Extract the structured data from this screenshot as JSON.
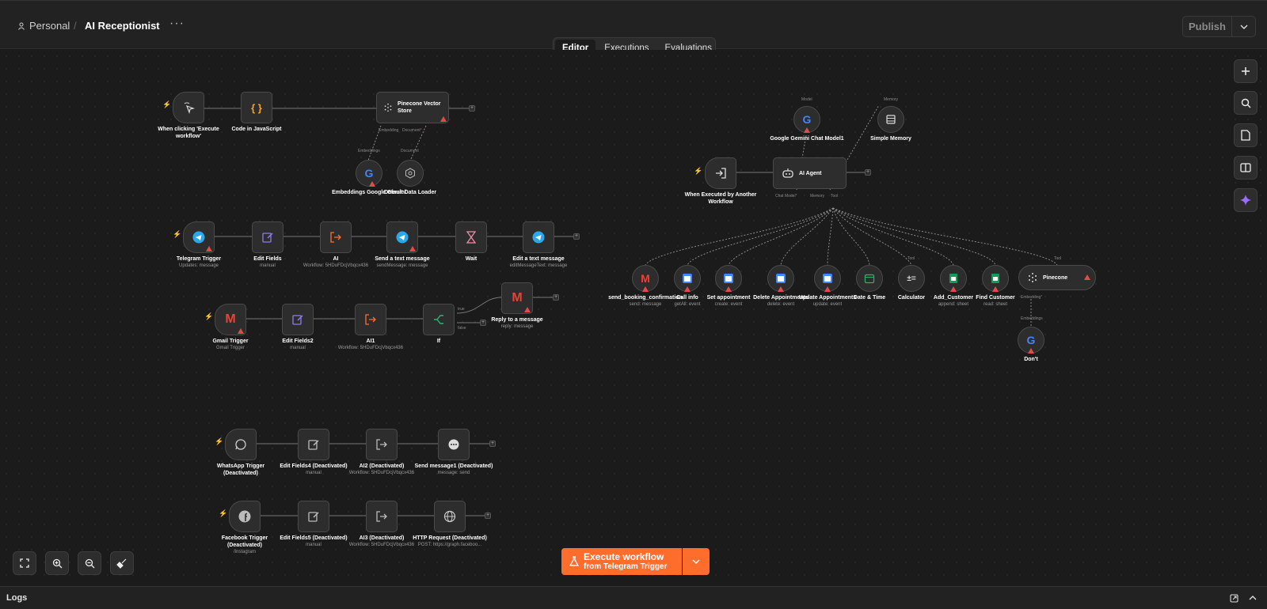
{
  "header": {
    "breadcrumb_personal": "Personal",
    "breadcrumb_separator": "/",
    "workflow_title": "AI Receptionist",
    "more_label": "···",
    "publish_label": "Publish"
  },
  "tabs": [
    {
      "label": "Editor",
      "active": true
    },
    {
      "label": "Executions",
      "active": false
    },
    {
      "label": "Evaluations",
      "active": false
    }
  ],
  "nodes": {
    "manual_trigger": {
      "label": "When clicking 'Execute workflow'",
      "icon": "cursor-click-icon"
    },
    "code_js": {
      "label": "Code in JavaScript",
      "icon": "braces-icon",
      "glyph": "{ }"
    },
    "pinecone_store": {
      "label": "Pinecone Vector Store",
      "icon": "pinecone-icon"
    },
    "embeddings_gemini": {
      "label": "Embeddings Google Gemini",
      "icon": "google-icon"
    },
    "default_loader": {
      "label": "Default Data Loader",
      "icon": "hexagon-icon"
    },
    "telegram_trigger": {
      "label": "Telegram Trigger",
      "sub": "Updates: message",
      "icon": "telegram-icon"
    },
    "edit_fields": {
      "label": "Edit Fields",
      "sub": "manual",
      "icon": "pencil-icon"
    },
    "ai": {
      "label": "AI",
      "sub": "Workflow: 5HDuFDcjVbqcx436",
      "icon": "execute-workflow-icon"
    },
    "send_text": {
      "label": "Send a text message",
      "sub": "sendMessage: message",
      "icon": "telegram-icon"
    },
    "wait": {
      "label": "Wait",
      "icon": "hourglass-icon"
    },
    "edit_text": {
      "label": "Edit a text message",
      "sub": "editMessageText: message",
      "icon": "telegram-icon"
    },
    "gmail_trigger": {
      "label": "Gmail Trigger",
      "sub": "Gmail Trigger",
      "icon": "gmail-icon"
    },
    "edit_fields2": {
      "label": "Edit Fields2",
      "sub": "manual",
      "icon": "pencil-icon"
    },
    "ai1": {
      "label": "AI1",
      "sub": "Workflow: 5HDuFDcjVbqcx436",
      "icon": "execute-workflow-icon"
    },
    "if": {
      "label": "If",
      "icon": "branch-icon",
      "true_label": "true",
      "false_label": "false"
    },
    "reply_message": {
      "label": "Reply to a message",
      "sub": "reply: message",
      "icon": "gmail-icon"
    },
    "whatsapp_trigger": {
      "label": "WhatsApp Trigger (Deactivated)",
      "icon": "whatsapp-icon"
    },
    "edit_fields4": {
      "label": "Edit Fields4 (Deactivated)",
      "sub": "manual",
      "icon": "pencil-icon"
    },
    "ai2": {
      "label": "AI2 (Deactivated)",
      "sub": "Workflow: 5HDuFDcjVbqcx436",
      "icon": "execute-workflow-icon"
    },
    "send_message1": {
      "label": "Send message1 (Deactivated)",
      "sub": "message: send",
      "icon": "chat-icon"
    },
    "facebook_trigger": {
      "label": "Facebook Trigger (Deactivated)",
      "sub": "/instagram",
      "icon": "facebook-icon"
    },
    "edit_fields5": {
      "label": "Edit Fields5 (Deactivated)",
      "sub": "manual",
      "icon": "pencil-icon"
    },
    "ai3": {
      "label": "AI3 (Deactivated)",
      "sub": "Workflow: 5HDuFDcjVbqcx436",
      "icon": "execute-workflow-icon"
    },
    "http_request": {
      "label": "HTTP Request (Deactivated)",
      "sub": "POST: https://graph.faceboo...",
      "icon": "globe-icon"
    },
    "gemini_chat": {
      "label": "Google Gemini Chat Model1",
      "icon": "google-icon"
    },
    "simple_memory": {
      "label": "Simple Memory",
      "icon": "database-icon"
    },
    "executed_trigger": {
      "label": "When Executed by Another Workflow",
      "icon": "enter-icon"
    },
    "ai_agent": {
      "label": "AI Agent",
      "icon": "robot-icon"
    },
    "send_booking": {
      "label": "send_booking_confirmation",
      "sub": "send: message",
      "icon": "gmail-icon"
    },
    "call_info": {
      "label": "Call info",
      "sub": "getAll: event",
      "icon": "calendar-icon"
    },
    "set_appointment": {
      "label": "Set appointment",
      "sub": "create: event",
      "icon": "calendar-icon"
    },
    "delete_appointments": {
      "label": "Delete Appointments",
      "sub": "delete: event",
      "icon": "calendar-icon"
    },
    "update_appointments": {
      "label": "Update Appointments",
      "sub": "update: event",
      "icon": "calendar-icon"
    },
    "date_time": {
      "label": "Date & Time",
      "icon": "calendar-check-icon"
    },
    "calculator": {
      "label": "Calculator",
      "icon": "calculator-icon"
    },
    "add_customer": {
      "label": "Add_Customer",
      "sub": "append: sheet",
      "icon": "sheets-icon"
    },
    "find_customer": {
      "label": "Find Customer",
      "sub": "read: sheet",
      "icon": "sheets-icon"
    },
    "pinecone": {
      "label": "Pinecone",
      "icon": "pinecone-icon"
    },
    "dont": {
      "label": "Don't",
      "icon": "google-icon"
    }
  },
  "port_labels": {
    "embedding_doc": "Embedding",
    "document_short": "Document",
    "embeddings": "Embeddings",
    "document": "Document",
    "model": "Model",
    "memory": "Memory",
    "chat_model": "Chat Model",
    "memory_port": "Memory",
    "tool_port": "Tool",
    "tool_left": "Tool",
    "tool_right": "Tool",
    "pinecone_embedding": "Embedding",
    "embeddings_bottom": "Embeddings",
    "required_mark": "*"
  },
  "execute": {
    "main_label": "Execute workflow",
    "sub_label": "from Telegram Trigger"
  },
  "logs": {
    "title": "Logs"
  },
  "colors": {
    "accent": "#ff6d2d",
    "background": "#1b1b1b",
    "warning": "#e04b4b"
  }
}
